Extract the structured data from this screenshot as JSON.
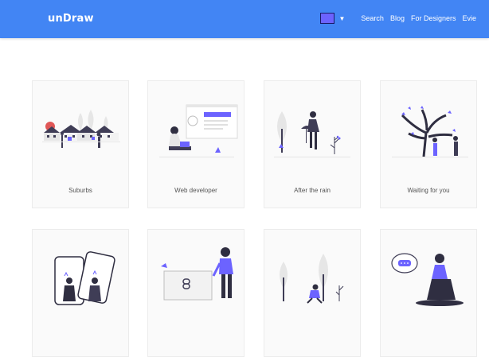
{
  "header": {
    "brand": "unDraw",
    "accent_color": "#6c63ff",
    "nav": [
      "Search",
      "Blog",
      "For Designers",
      "Evie"
    ]
  },
  "gallery": {
    "items": [
      {
        "label": "Suburbs",
        "icon": "suburbs-illustration"
      },
      {
        "label": "Web developer",
        "icon": "web-developer-illustration"
      },
      {
        "label": "After the rain",
        "icon": "after-the-rain-illustration"
      },
      {
        "label": "Waiting for you",
        "icon": "waiting-for-you-illustration"
      },
      {
        "label": "",
        "icon": "selfie-photos-illustration"
      },
      {
        "label": "",
        "icon": "link-illustration"
      },
      {
        "label": "",
        "icon": "outdoor-person-illustration"
      },
      {
        "label": "",
        "icon": "chat-woman-illustration"
      }
    ]
  }
}
